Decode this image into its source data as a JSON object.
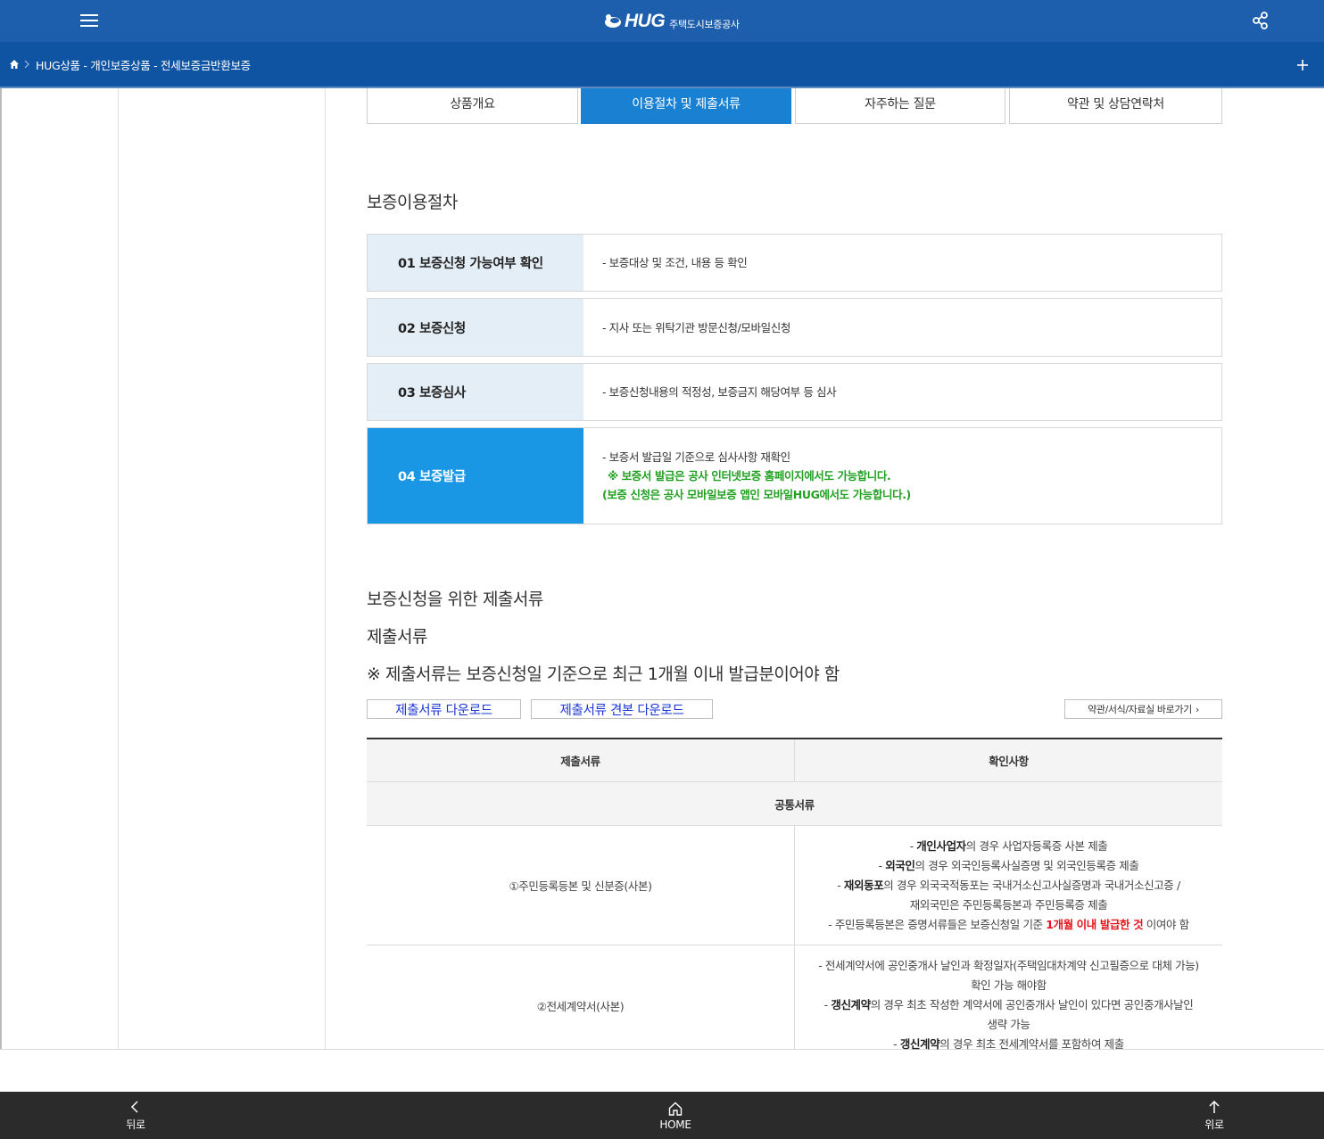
{
  "header": {
    "logo_text": "HUG",
    "logo_sub": "주택도시보증공사",
    "menu_icon": "hamburger-icon",
    "share_icon": "share-icon",
    "color": "#1d5fac"
  },
  "breadcrumb": {
    "text": "HUG상품 - 개인보증상품 - 전세보증금반환보증",
    "home_icon": "home-icon",
    "plus_icon": "plus-icon"
  },
  "tabs": [
    {
      "label": "상품개요",
      "active": false
    },
    {
      "label": "이용절차 및 제출서류",
      "active": true
    },
    {
      "label": "자주하는 질문",
      "active": false
    },
    {
      "label": "약관 및 상담연락처",
      "active": false
    }
  ],
  "procedure": {
    "title": "보증이용절차",
    "steps": [
      {
        "label": "01 보증신청 가능여부 확인",
        "desc": "- 보증대상 및 조건, 내용 등 확인"
      },
      {
        "label": "02 보증신청",
        "desc": "- 지사 또는 위탁기관  방문신청/모바일신청"
      },
      {
        "label": "03 보증심사",
        "desc": "- 보증신청내용의 적정성, 보증금지 해당여부 등 심사"
      },
      {
        "label": "04 보증발급",
        "desc": "- 보증서 발급일 기준으로 심사사항 재확인",
        "note1": "※ 보증서 발급은 공사 인터넷보증 홈페이지에서도 가능합니다.",
        "note2": "(보증 신청은 공사 모바일보증 앱인 모바일HUG에서도 가능합니다.)"
      }
    ]
  },
  "documents": {
    "title": "보증신청을 위한 제출서류",
    "subtitle": "제출서류",
    "notice": "※ 제출서류는 보증신청일 기준으로 최근 1개월 이내 발급분이어야 함",
    "download_btn": "제출서류 다운로드",
    "sample_btn": "제출서류 견본 다운로드",
    "link_btn": "약관/서식/자료실 바로가기",
    "table": {
      "headers": [
        "제출서류",
        "확인사항"
      ],
      "group": "공통서류",
      "row1": {
        "doc": "①주민등록등본 및 신분증(사본)",
        "l1_b": "개인사업자",
        "l1": "의 경우 사업자등록증 사본 제출",
        "l2_b": "외국인",
        "l2": "의 경우 외국인등록사실증명 및 외국인등록증 제출",
        "l3_b": "재외동포",
        "l3": "의 경우 외국국적동포는 국내거소신고사실증명과 국내거소신고증 /",
        "l4": "재외국민은 주민등록등본과 주민등록증 제출",
        "l5a": "- 주민등록등본은 증명서류들은 보증신청일 기준 ",
        "l5_red": "1개월 이내 발급한 것",
        "l5b": " 이여야 함"
      },
      "row2": {
        "doc": "②전세계약서(사본)",
        "l1": "- 전세계약서에 공인중개사 날인과 확정일자(주택임대차계약 신고필증으로 대체 가능)",
        "l2": "확인 가능 해야함",
        "l3_b": "갱신계약",
        "l3": "의 경우 최초 작성한 계약서에 공인중개사 날인이 있다면 공인중개사날인",
        "l4": "생략 가능",
        "l5_b": "갱신계약",
        "l5": "의 경우 최초 전세계약서를 포함하여 제출"
      }
    }
  },
  "bottom_nav": {
    "back": "뒤로",
    "home": "HOME",
    "top": "위로"
  }
}
